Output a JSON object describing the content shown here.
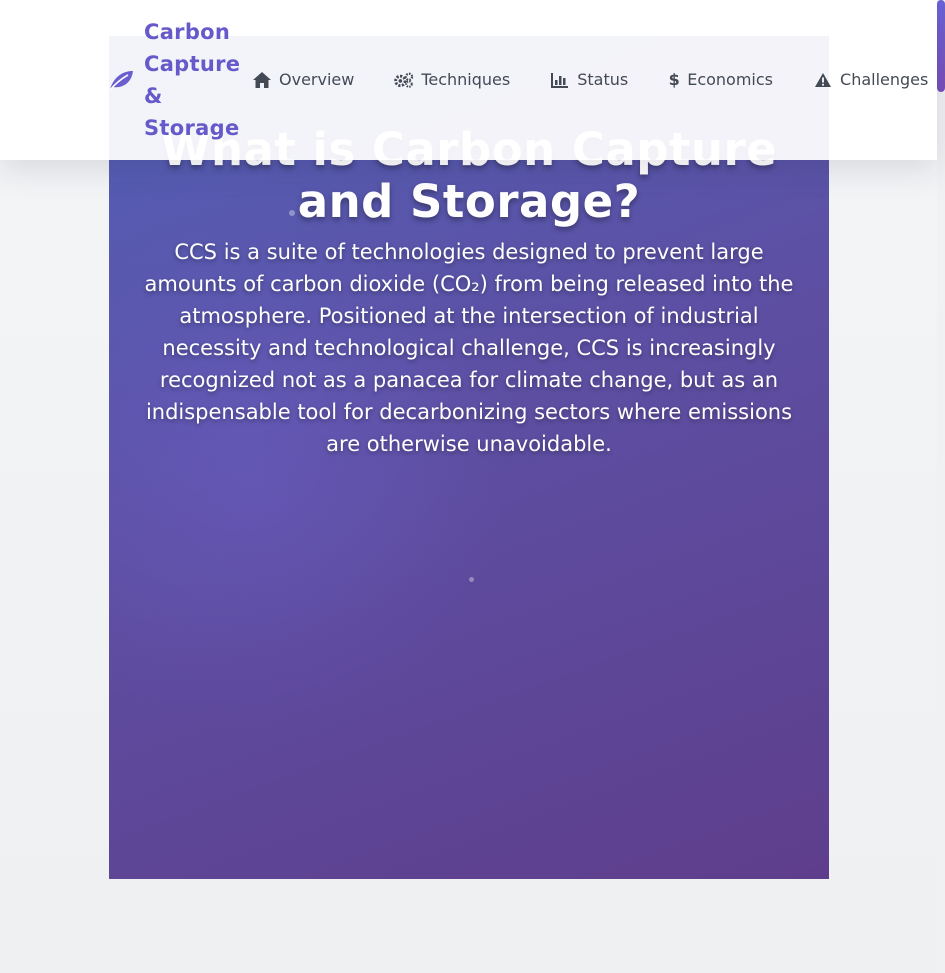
{
  "brand": {
    "name": "Carbon Capture & Storage",
    "icon": "leaf-icon",
    "color": "#6659c9"
  },
  "nav": {
    "items": [
      {
        "label": "Overview",
        "icon": "home-icon"
      },
      {
        "label": "Techniques",
        "icon": "gears-icon"
      },
      {
        "label": "Status",
        "icon": "chart-icon"
      },
      {
        "label": "Economics",
        "icon": "dollar-icon"
      },
      {
        "label": "Challenges",
        "icon": "warning-icon"
      }
    ]
  },
  "hero": {
    "title": "What is Carbon Capture and Storage?",
    "description": "CCS is a suite of technologies designed to prevent large amounts of carbon dioxide (CO₂) from being released into the atmosphere. Positioned at the intersection of industrial necessity and technological challenge, CCS is increasingly recognized not as a panacea for climate change, but as an indispensable tool for decarbonizing sectors where emissions are otherwise unavoidable.",
    "gradient_start": "#5361b8",
    "gradient_end": "#5e3e8c"
  }
}
